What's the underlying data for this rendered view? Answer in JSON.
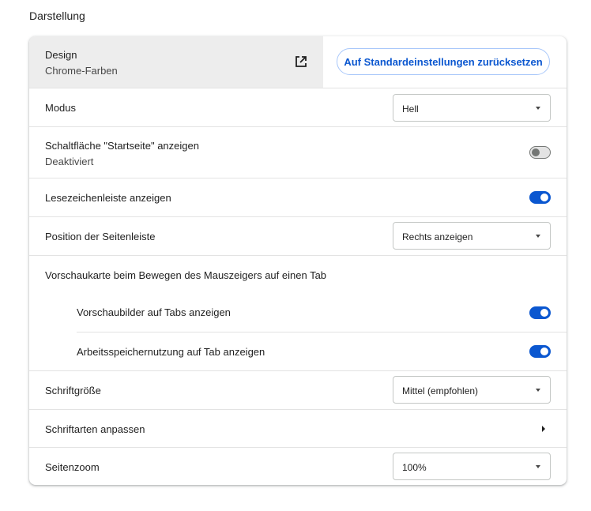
{
  "section_title": "Darstellung",
  "design": {
    "label": "Design",
    "value": "Chrome-Farben",
    "open_icon": "open-in-new-icon",
    "reset_label": "Auf Standardeinstellungen zurücksetzen"
  },
  "mode": {
    "label": "Modus",
    "value": "Hell"
  },
  "home_button": {
    "label": "Schaltfläche \"Startseite\" anzeigen",
    "status": "Deaktiviert",
    "enabled": false
  },
  "bookmarks_bar": {
    "label": "Lesezeichenleiste anzeigen",
    "enabled": true
  },
  "side_panel": {
    "label": "Position der Seitenleiste",
    "value": "Rechts anzeigen"
  },
  "hover_card": {
    "label": "Vorschaukarte beim Bewegen des Mauszeigers auf einen Tab",
    "preview_images": {
      "label": "Vorschaubilder auf Tabs anzeigen",
      "enabled": true
    },
    "memory_usage": {
      "label": "Arbeitsspeichernutzung auf Tab anzeigen",
      "enabled": true
    }
  },
  "font_size": {
    "label": "Schriftgröße",
    "value": "Mittel (empfohlen)"
  },
  "customize_fonts": {
    "label": "Schriftarten anpassen"
  },
  "page_zoom": {
    "label": "Seitenzoom",
    "value": "100%"
  },
  "colors": {
    "accent": "#0b57d0",
    "toggle_off": "#e3e3e3",
    "design_row_bg": "#ededed"
  }
}
